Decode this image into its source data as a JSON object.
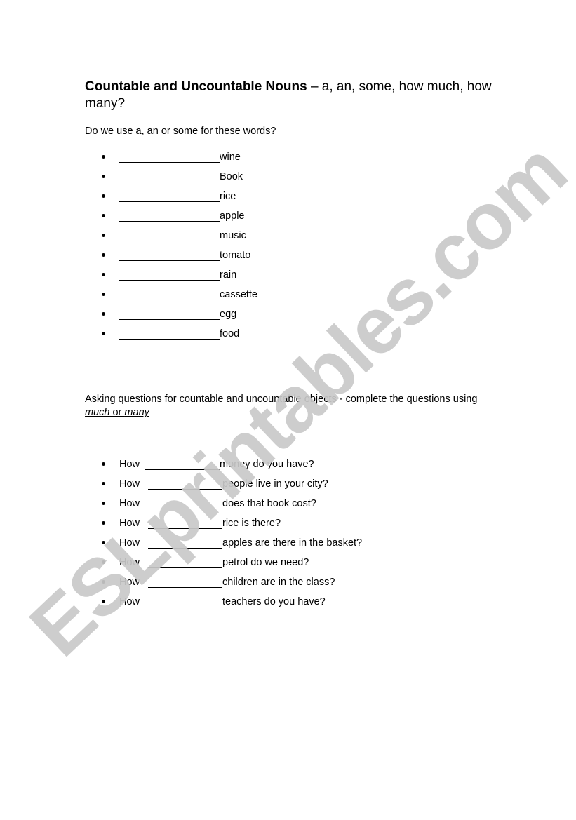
{
  "title": {
    "bold": "Countable and Uncountable Nouns",
    "rest": " – a, an, some, how much, how many?"
  },
  "section1": {
    "instruction": "Do we use a, an or some for these words?",
    "items": [
      {
        "word": "wine"
      },
      {
        "word": "Book"
      },
      {
        "word": "rice"
      },
      {
        "word": "apple"
      },
      {
        "word": "music"
      },
      {
        "word": "tomato"
      },
      {
        "word": "rain"
      },
      {
        "word": "cassette"
      },
      {
        "word": "egg"
      },
      {
        "word": "food"
      }
    ]
  },
  "section2": {
    "instruction_prefix": "Asking questions for countable and uncountable objects - complete the questions using ",
    "instruction_em1": "much",
    "instruction_mid": " or ",
    "instruction_em2": "many",
    "items": [
      {
        "how": "How",
        "rest": "money do you have?"
      },
      {
        "how": "How",
        "rest": "people live in your city?"
      },
      {
        "how": "How",
        "rest": "does that book cost?"
      },
      {
        "how": "How",
        "rest": "rice is there?"
      },
      {
        "how": "How",
        "rest": "apples are there in the basket?"
      },
      {
        "how": "How",
        "rest": "petrol do we need?"
      },
      {
        "how": "How",
        "rest": "children are in the class?"
      },
      {
        "how": "How",
        "rest": "teachers do you have?"
      }
    ]
  },
  "watermark": {
    "text": "ESLprintables.com",
    "color": "#c9c9c9"
  }
}
